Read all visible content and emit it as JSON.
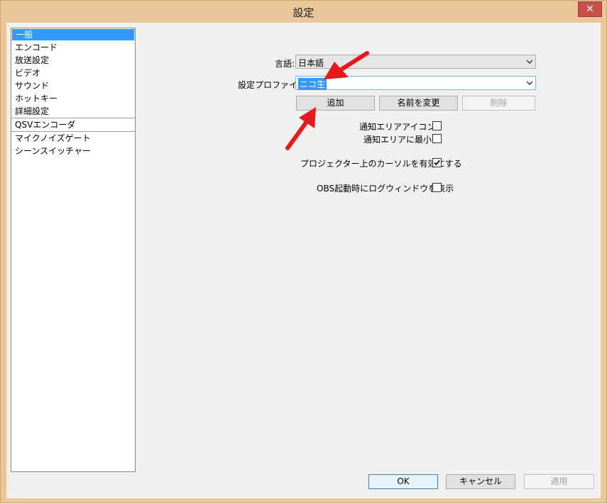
{
  "window": {
    "title": "設定",
    "close_symbol": "✕"
  },
  "sidebar": {
    "items": [
      {
        "label": "一般",
        "selected": true
      },
      {
        "label": "エンコード"
      },
      {
        "label": "放送設定"
      },
      {
        "label": "ビデオ"
      },
      {
        "label": "サウンド"
      },
      {
        "label": "ホットキー"
      },
      {
        "label": "詳細設定"
      },
      {
        "label": "QSVエンコーダ"
      },
      {
        "label": "マイクノイズゲート"
      },
      {
        "label": "シーンスイッチャー"
      }
    ]
  },
  "general": {
    "language_label": "言語:",
    "language_value": "日本語",
    "profile_label": "設定プロファイル:",
    "profile_value": "ニコ生",
    "add_label": "追加",
    "rename_label": "名前を変更",
    "delete_label": "削除",
    "notify_icon_label": "通知エリアアイコン",
    "minimize_tray_label": "通知エリアに最小化",
    "projector_cursor_label": "プロジェクター上のカーソルを有効にする",
    "show_log_label": "OBS起動時にログウィンドウを表示",
    "checks": {
      "notify_icon": false,
      "minimize_tray": false,
      "projector_cursor": true,
      "show_log": false
    }
  },
  "footer": {
    "ok_label": "OK",
    "cancel_label": "キャンセル",
    "apply_label": "適用"
  },
  "colors": {
    "accent": "#3399ff",
    "frame": "#e9c79a",
    "close": "#c7504a",
    "annotation": "#e8191a"
  }
}
